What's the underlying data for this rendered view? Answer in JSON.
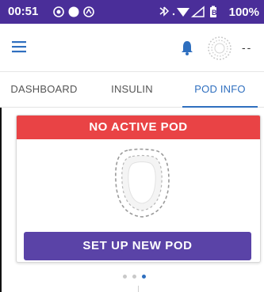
{
  "status_bar": {
    "time": "00:51",
    "battery": "100%",
    "background_color": "#4a2e99"
  },
  "app_bar": {
    "menu_icon": "hamburger-menu-icon",
    "bell_icon": "bell-icon",
    "pod_status_text": "--"
  },
  "tabs": [
    {
      "label": "DASHBOARD",
      "active": false
    },
    {
      "label": "INSULIN",
      "active": false
    },
    {
      "label": "POD INFO",
      "active": true
    }
  ],
  "card": {
    "banner_text": "NO ACTIVE POD",
    "banner_color": "#e94345",
    "button_label": "SET UP NEW POD",
    "button_color": "#5a43a7"
  },
  "pager": {
    "pages": 3,
    "active_index": 2,
    "accent_color": "#2f6fbf"
  }
}
